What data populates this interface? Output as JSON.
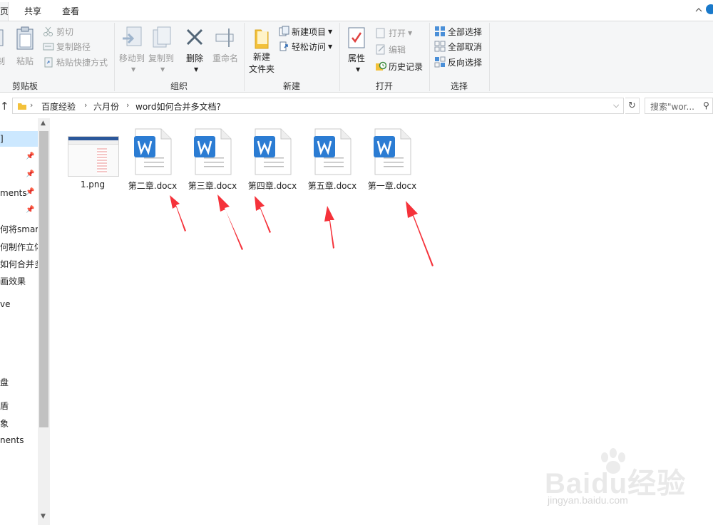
{
  "tabs": {
    "home_fragment": "页",
    "share": "共享",
    "view": "查看"
  },
  "ribbon": {
    "clipboard": {
      "partial_label": "制",
      "paste": "粘贴",
      "cut": "剪切",
      "copy_path": "复制路径",
      "paste_shortcut": "粘贴快捷方式",
      "group": "剪贴板"
    },
    "organize": {
      "move_to": "移动到",
      "copy_to": "复制到",
      "delete": "删除",
      "rename": "重命名",
      "group": "组织"
    },
    "new": {
      "new_folder": "新建\n文件夹",
      "new_folder_line1": "新建",
      "new_folder_line2": "文件夹",
      "new_item": "新建项目",
      "easy_access": "轻松访问",
      "group": "新建"
    },
    "open": {
      "properties": "属性",
      "open": "打开",
      "edit": "编辑",
      "history": "历史记录",
      "group": "打开"
    },
    "select": {
      "select_all": "全部选择",
      "select_none": "全部取消",
      "invert": "反向选择",
      "group": "选择"
    }
  },
  "address": {
    "crumbs": [
      "百度经验",
      "六月份",
      "word如何合并多文档?"
    ],
    "search_placeholder": "搜索\"wor..."
  },
  "nav": {
    "items": [
      "]",
      "ments",
      "何将smar",
      "何制作立体",
      "如何合并多",
      "画效果",
      "ve",
      "盘",
      "盾",
      "象",
      "nents"
    ]
  },
  "files": [
    {
      "name": "1.png",
      "type": "image"
    },
    {
      "name": "第二章.docx",
      "type": "word"
    },
    {
      "name": "第三章.docx",
      "type": "word"
    },
    {
      "name": "第四章.docx",
      "type": "word"
    },
    {
      "name": "第五章.docx",
      "type": "word"
    },
    {
      "name": "第一章.docx",
      "type": "word"
    }
  ],
  "watermark": {
    "brand": "Baidu经验",
    "url": "jingyan.baidu.com"
  },
  "colors": {
    "accent": "#1979ca",
    "word_blue": "#2b7cd3",
    "arrow_red": "#f5323a",
    "selection": "#cce8ff"
  }
}
